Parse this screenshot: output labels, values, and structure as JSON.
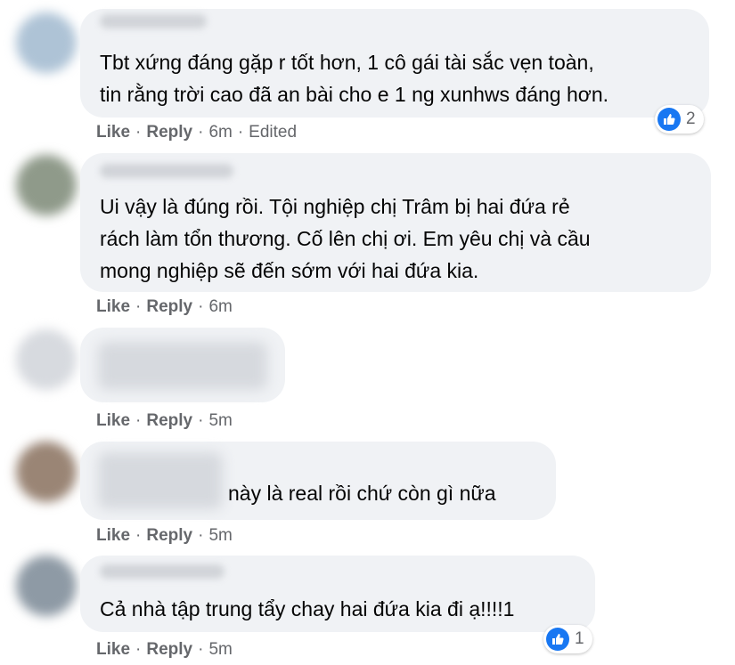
{
  "colors": {
    "bubble": "#f0f2f5",
    "link": "#65676b",
    "like_blue": "#1877f2"
  },
  "comments": [
    {
      "text": "Tbt xứng đáng gặp r tốt hơn, 1 cô gái tài sắc vẹn toàn,\ntin rằng trời cao đã an bài cho e 1 ng xunhws đáng hơn.",
      "like_label": "Like",
      "reply_label": "Reply",
      "time": "6m",
      "edited": "Edited",
      "reaction_icon": "like-icon",
      "reaction_count": "2"
    },
    {
      "text": "Ui vậy là đúng rồi. Tội nghiệp chị Trâm bị hai đứa rẻ\nrách làm tổn thương. Cố lên chị ơi. Em yêu chị và cầu\nmong nghiệp sẽ đến sớm với hai đứa kia.",
      "like_label": "Like",
      "reply_label": "Reply",
      "time": "6m"
    },
    {
      "text": "",
      "like_label": "Like",
      "reply_label": "Reply",
      "time": "5m"
    },
    {
      "text": "này là real rồi chứ còn gì nữa",
      "like_label": "Like",
      "reply_label": "Reply",
      "time": "5m"
    },
    {
      "text": "Cả nhà tập trung tẩy chay hai đứa kia đi ạ!!!!1",
      "like_label": "Like",
      "reply_label": "Reply",
      "time": "5m",
      "reaction_icon": "like-icon",
      "reaction_count": "1"
    }
  ]
}
